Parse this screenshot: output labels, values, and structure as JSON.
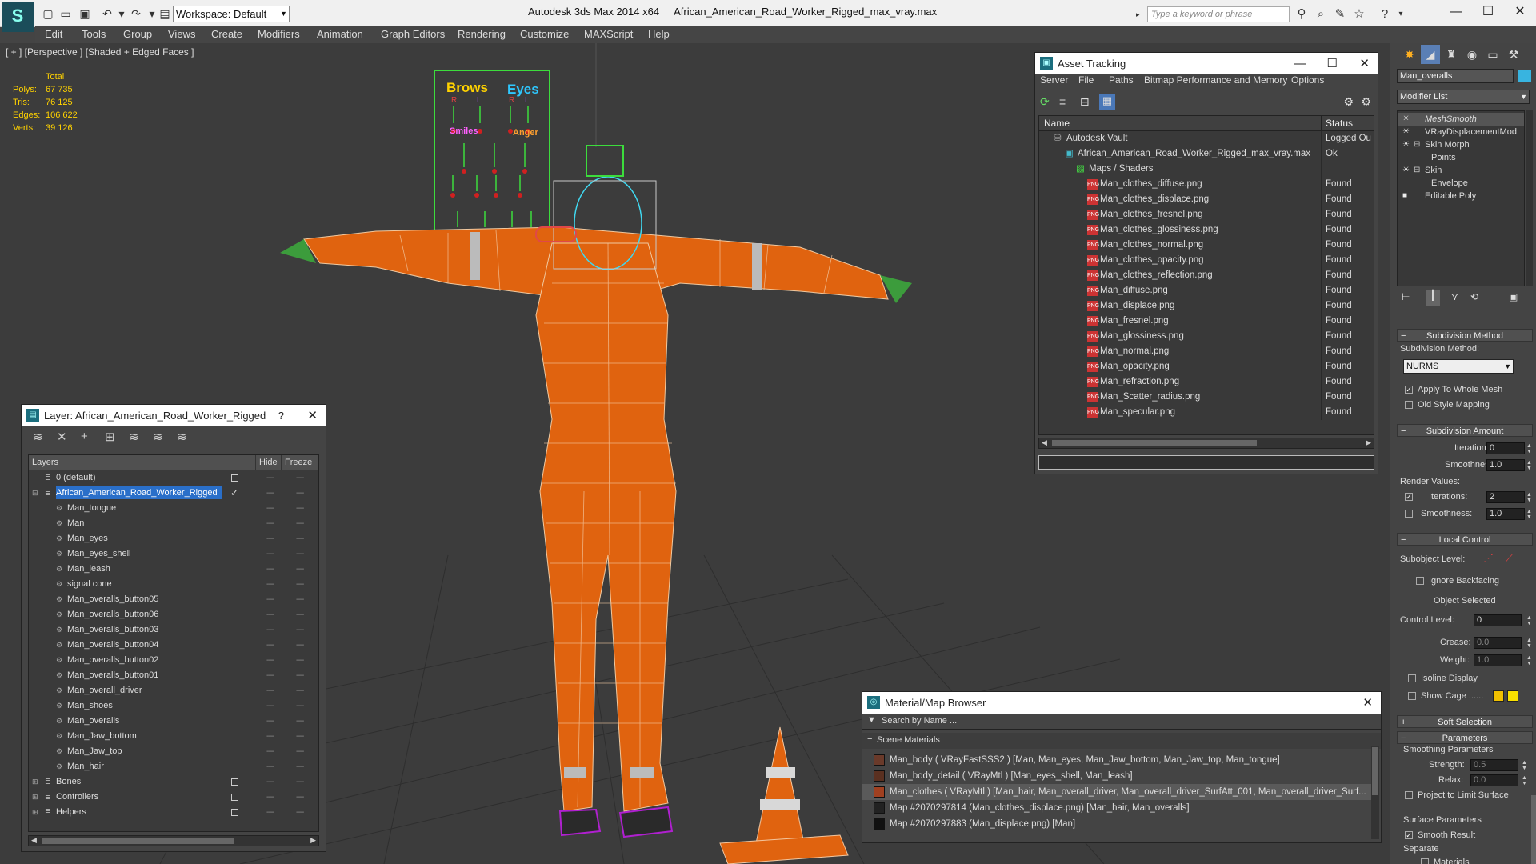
{
  "titlebar": {
    "app_title": "Autodesk 3ds Max  2014 x64",
    "file_title": "African_American_Road_Worker_Rigged_max_vray.max",
    "workspace": "Workspace: Default",
    "search_placeholder": "Type a keyword or phrase"
  },
  "menu": [
    "Edit",
    "Tools",
    "Group",
    "Views",
    "Create",
    "Modifiers",
    "Animation",
    "Graph Editors",
    "Rendering",
    "Customize",
    "MAXScript",
    "Help"
  ],
  "viewport": {
    "label": "[ + ] [Perspective ] [Shaded + Edged Faces ]",
    "stats_header": "Total",
    "stats": [
      {
        "label": "Polys:",
        "value": "67 735"
      },
      {
        "label": "Tris:",
        "value": "76 125"
      },
      {
        "label": "Edges:",
        "value": "106 622"
      },
      {
        "label": "Verts:",
        "value": "39 126"
      }
    ],
    "face_board": {
      "brows": "Brows",
      "eyes": "Eyes",
      "r": "R",
      "l": "L",
      "smiles": "Smiles",
      "angers": "Anger"
    }
  },
  "layer_panel": {
    "title": "Layer: African_American_Road_Worker_Rigged",
    "help": "?",
    "col_layers": "Layers",
    "col_hide": "Hide",
    "col_freeze": "Freeze",
    "rows": [
      {
        "name": "0 (default)",
        "level": 0,
        "type": "layer",
        "box": true
      },
      {
        "name": "African_American_Road_Worker_Rigged",
        "level": 0,
        "type": "layer",
        "selected": true,
        "check": true
      },
      {
        "name": "Man_tongue",
        "level": 1,
        "type": "obj"
      },
      {
        "name": "Man",
        "level": 1,
        "type": "obj"
      },
      {
        "name": "Man_eyes",
        "level": 1,
        "type": "obj"
      },
      {
        "name": "Man_eyes_shell",
        "level": 1,
        "type": "obj"
      },
      {
        "name": "Man_leash",
        "level": 1,
        "type": "obj"
      },
      {
        "name": "signal cone",
        "level": 1,
        "type": "obj"
      },
      {
        "name": "Man_overalls_button05",
        "level": 1,
        "type": "obj"
      },
      {
        "name": "Man_overalls_button06",
        "level": 1,
        "type": "obj"
      },
      {
        "name": "Man_overalls_button03",
        "level": 1,
        "type": "obj"
      },
      {
        "name": "Man_overalls_button04",
        "level": 1,
        "type": "obj"
      },
      {
        "name": "Man_overalls_button02",
        "level": 1,
        "type": "obj"
      },
      {
        "name": "Man_overalls_button01",
        "level": 1,
        "type": "obj"
      },
      {
        "name": "Man_overall_driver",
        "level": 1,
        "type": "obj"
      },
      {
        "name": "Man_shoes",
        "level": 1,
        "type": "obj"
      },
      {
        "name": "Man_overalls",
        "level": 1,
        "type": "obj"
      },
      {
        "name": "Man_Jaw_bottom",
        "level": 1,
        "type": "obj"
      },
      {
        "name": "Man_Jaw_top",
        "level": 1,
        "type": "obj"
      },
      {
        "name": "Man_hair",
        "level": 1,
        "type": "obj"
      },
      {
        "name": "Bones",
        "level": 0,
        "type": "group",
        "box": true
      },
      {
        "name": "Controllers",
        "level": 0,
        "type": "group",
        "box": true
      },
      {
        "name": "Helpers",
        "level": 0,
        "type": "group",
        "box": true
      }
    ]
  },
  "asset_tracking": {
    "title": "Asset Tracking",
    "menu": [
      "Server",
      "File",
      "Paths",
      "Bitmap Performance and Memory",
      "Options"
    ],
    "col_name": "Name",
    "col_status": "Status",
    "rows": [
      {
        "name": "Autodesk Vault",
        "status": "Logged Ou",
        "indent": 1,
        "icon": "vault"
      },
      {
        "name": "African_American_Road_Worker_Rigged_max_vray.max",
        "status": "Ok",
        "indent": 2,
        "icon": "max"
      },
      {
        "name": "Maps / Shaders",
        "status": "",
        "indent": 3,
        "icon": "maps"
      },
      {
        "name": "Man_clothes_diffuse.png",
        "status": "Found",
        "indent": 4,
        "icon": "png"
      },
      {
        "name": "Man_clothes_displace.png",
        "status": "Found",
        "indent": 4,
        "icon": "png"
      },
      {
        "name": "Man_clothes_fresnel.png",
        "status": "Found",
        "indent": 4,
        "icon": "png"
      },
      {
        "name": "Man_clothes_glossiness.png",
        "status": "Found",
        "indent": 4,
        "icon": "png"
      },
      {
        "name": "Man_clothes_normal.png",
        "status": "Found",
        "indent": 4,
        "icon": "png"
      },
      {
        "name": "Man_clothes_opacity.png",
        "status": "Found",
        "indent": 4,
        "icon": "png"
      },
      {
        "name": "Man_clothes_reflection.png",
        "status": "Found",
        "indent": 4,
        "icon": "png"
      },
      {
        "name": "Man_diffuse.png",
        "status": "Found",
        "indent": 4,
        "icon": "png"
      },
      {
        "name": "Man_displace.png",
        "status": "Found",
        "indent": 4,
        "icon": "png"
      },
      {
        "name": "Man_fresnel.png",
        "status": "Found",
        "indent": 4,
        "icon": "png"
      },
      {
        "name": "Man_glossiness.png",
        "status": "Found",
        "indent": 4,
        "icon": "png"
      },
      {
        "name": "Man_normal.png",
        "status": "Found",
        "indent": 4,
        "icon": "png"
      },
      {
        "name": "Man_opacity.png",
        "status": "Found",
        "indent": 4,
        "icon": "png"
      },
      {
        "name": "Man_refraction.png",
        "status": "Found",
        "indent": 4,
        "icon": "png"
      },
      {
        "name": "Man_Scatter_radius.png",
        "status": "Found",
        "indent": 4,
        "icon": "png"
      },
      {
        "name": "Man_specular.png",
        "status": "Found",
        "indent": 4,
        "icon": "png"
      }
    ]
  },
  "material_browser": {
    "title": "Material/Map Browser",
    "search_placeholder": "Search by Name ...",
    "section": "Scene Materials",
    "rows": [
      {
        "text": "Man_body  ( VRayFastSSS2 ) [Man, Man_eyes, Man_Jaw_bottom, Man_Jaw_top, Man_tongue]",
        "swatch": "#6a3a2a"
      },
      {
        "text": "Man_body_detail  ( VRayMtl ) [Man_eyes_shell, Man_leash]",
        "swatch": "#5a3020"
      },
      {
        "text": "Man_clothes  ( VRayMtl ) [Man_hair, Man_overall_driver, Man_overall_driver_SurfAtt_001, Man_overall_driver_Surf...",
        "swatch": "#a04020"
      },
      {
        "text": "Map #2070297814 (Man_clothes_displace.png) [Man_hair, Man_overalls]",
        "swatch": "#222222"
      },
      {
        "text": "Map #2070297883 (Man_displace.png) [Man]",
        "swatch": "#111111"
      }
    ]
  },
  "command_panel": {
    "object_name": "Man_overalls",
    "modifier_list": "Modifier List",
    "stack": [
      {
        "name": "MeshSmooth",
        "level": 0,
        "italic": true
      },
      {
        "name": "VRayDisplacementMod",
        "level": 0
      },
      {
        "name": "Skin Morph",
        "level": 0,
        "expand": true
      },
      {
        "name": "Points",
        "level": 1
      },
      {
        "name": "Skin",
        "level": 0,
        "expand": true
      },
      {
        "name": "Envelope",
        "level": 1
      },
      {
        "name": "Editable Poly",
        "level": 0
      }
    ],
    "subdivision_method_title": "Subdivision Method",
    "subdivision_method_label": "Subdivision Method:",
    "subdivision_method_value": "NURMS",
    "apply_whole_mesh": "Apply To Whole Mesh",
    "old_style_mapping": "Old Style Mapping",
    "subdivision_amount_title": "Subdivision Amount",
    "iterations_label": "Iterations:",
    "iterations_value": "0",
    "smoothness_label": "Smoothness:",
    "smoothness_value": "1.0",
    "render_values": "Render Values:",
    "render_iterations_value": "2",
    "render_smoothness_value": "1.0",
    "local_control_title": "Local Control",
    "subobject_level": "Subobject Level:",
    "ignore_backfacing": "Ignore Backfacing",
    "object_selected": "Object Selected",
    "control_level": "Control Level:",
    "control_level_value": "0",
    "crease": "Crease:",
    "crease_value": "0.0",
    "weight": "Weight:",
    "weight_value": "1.0",
    "isoline_display": "Isoline Display",
    "show_cage": "Show Cage ......",
    "soft_selection_title": "Soft Selection",
    "parameters_title": "Parameters",
    "smoothing_parameters": "Smoothing Parameters",
    "strength": "Strength:",
    "strength_value": "0.5",
    "relax": "Relax:",
    "relax_value": "0.0",
    "project_limit": "Project to Limit Surface",
    "surface_parameters": "Surface Parameters",
    "smooth_result": "Smooth Result",
    "separate": "Separate",
    "materials": "Materials"
  }
}
